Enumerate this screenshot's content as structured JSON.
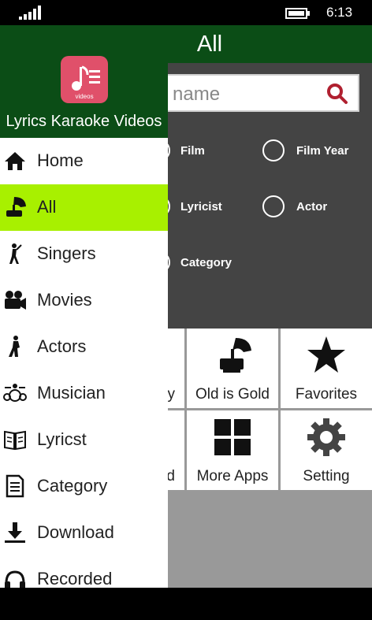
{
  "status": {
    "time": "6:13"
  },
  "header": {
    "title": "All"
  },
  "search": {
    "placeholder_visible": "name"
  },
  "filters": [
    {
      "label": "Film"
    },
    {
      "label": "Film Year"
    },
    {
      "label": "Lyricist"
    },
    {
      "label": "Actor"
    },
    {
      "label": "Category"
    }
  ],
  "tiles": [
    {
      "label": "y"
    },
    {
      "label": "Old is Gold",
      "icon": "gramophone-icon"
    },
    {
      "label": "Favorites",
      "icon": "star-icon"
    },
    {
      "label": "d"
    },
    {
      "label": "More Apps",
      "icon": "grid-icon"
    },
    {
      "label": "Setting",
      "icon": "gear-icon"
    }
  ],
  "drawer": {
    "app_name": "Lyrics Karaoke Videos",
    "logo_text": "videos",
    "items": [
      {
        "label": "Home",
        "icon": "home-icon"
      },
      {
        "label": "All",
        "icon": "gramophone-icon",
        "active": true
      },
      {
        "label": "Singers",
        "icon": "singer-icon"
      },
      {
        "label": "Movies",
        "icon": "camera-icon"
      },
      {
        "label": "Actors",
        "icon": "actor-icon"
      },
      {
        "label": "Musician",
        "icon": "drums-icon"
      },
      {
        "label": "Lyricst",
        "icon": "book-icon"
      },
      {
        "label": "Category",
        "icon": "list-icon"
      },
      {
        "label": "Download",
        "icon": "download-icon"
      },
      {
        "label": "Recorded",
        "icon": "headphones-icon"
      }
    ]
  },
  "colors": {
    "header": "#0b4d16",
    "active_item": "#a8f000",
    "search_icon": "#b02030",
    "logo": "#e0506a"
  }
}
